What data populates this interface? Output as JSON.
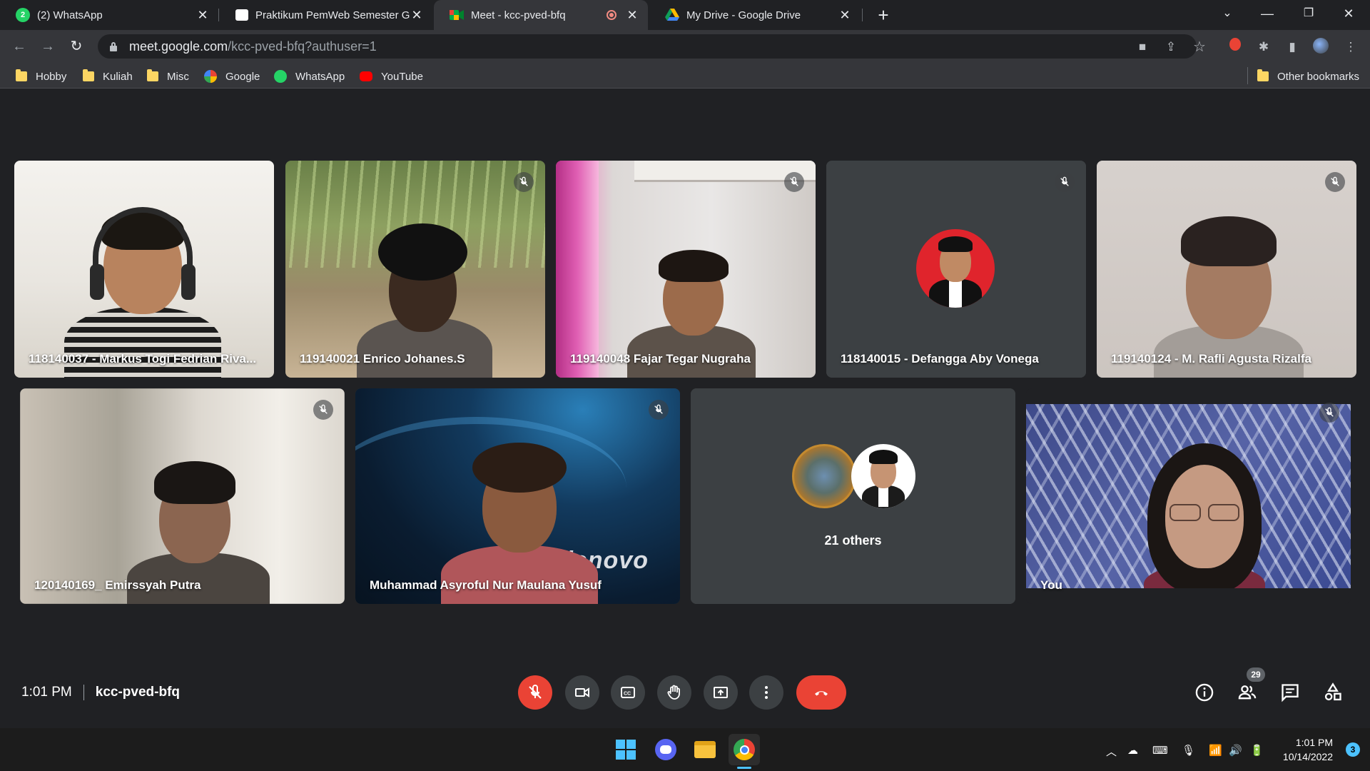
{
  "tabs": [
    {
      "title": "(2) WhatsApp",
      "icon": "whatsapp-icon"
    },
    {
      "title": "Praktikum PemWeb Semester Ga",
      "icon": "classroom-icon"
    },
    {
      "title": "Meet - kcc-pved-bfq",
      "icon": "meet-icon",
      "recording": true
    },
    {
      "title": "My Drive - Google Drive",
      "icon": "drive-icon"
    }
  ],
  "tab_badge": "2",
  "address": {
    "host": "meet.google.com",
    "path": "/kcc-pved-bfq?authuser=1"
  },
  "bookmarks": [
    {
      "label": "Hobby",
      "icon": "folder-icon"
    },
    {
      "label": "Kuliah",
      "icon": "folder-icon"
    },
    {
      "label": "Misc",
      "icon": "folder-icon"
    },
    {
      "label": "Google",
      "icon": "google-icon"
    },
    {
      "label": "WhatsApp",
      "icon": "whatsapp-icon"
    },
    {
      "label": "YouTube",
      "icon": "youtube-icon"
    }
  ],
  "other_bookmarks": "Other bookmarks",
  "participants": [
    {
      "name": "118140037 - Markus Togi Fedrian Riva...",
      "muted": false
    },
    {
      "name": "119140021 Enrico Johanes.S",
      "muted": true
    },
    {
      "name": "119140048 Fajar Tegar Nugraha",
      "muted": true
    },
    {
      "name": "118140015 - Defangga Aby Vonega",
      "muted": true
    },
    {
      "name": "119140124 - M. Rafli Agusta Rizalfa",
      "muted": true
    },
    {
      "name": "120140169_ Emirssyah Putra",
      "muted": true
    },
    {
      "name": "Muhammad Asyroful Nur Maulana Yusuf",
      "muted": true
    },
    {
      "name": "21 others",
      "muted": false
    },
    {
      "name": "You",
      "muted": true
    }
  ],
  "lenovo_text": "lenovo",
  "meeting": {
    "time": "1:01 PM",
    "code": "kcc-pved-bfq"
  },
  "people_count": "29",
  "taskbar": {
    "time": "1:01 PM",
    "date": "10/14/2022",
    "notifications": "3"
  },
  "colors": {
    "accent_red": "#ea4335",
    "control_bg": "#3c4043",
    "stage_bg": "#202124"
  }
}
